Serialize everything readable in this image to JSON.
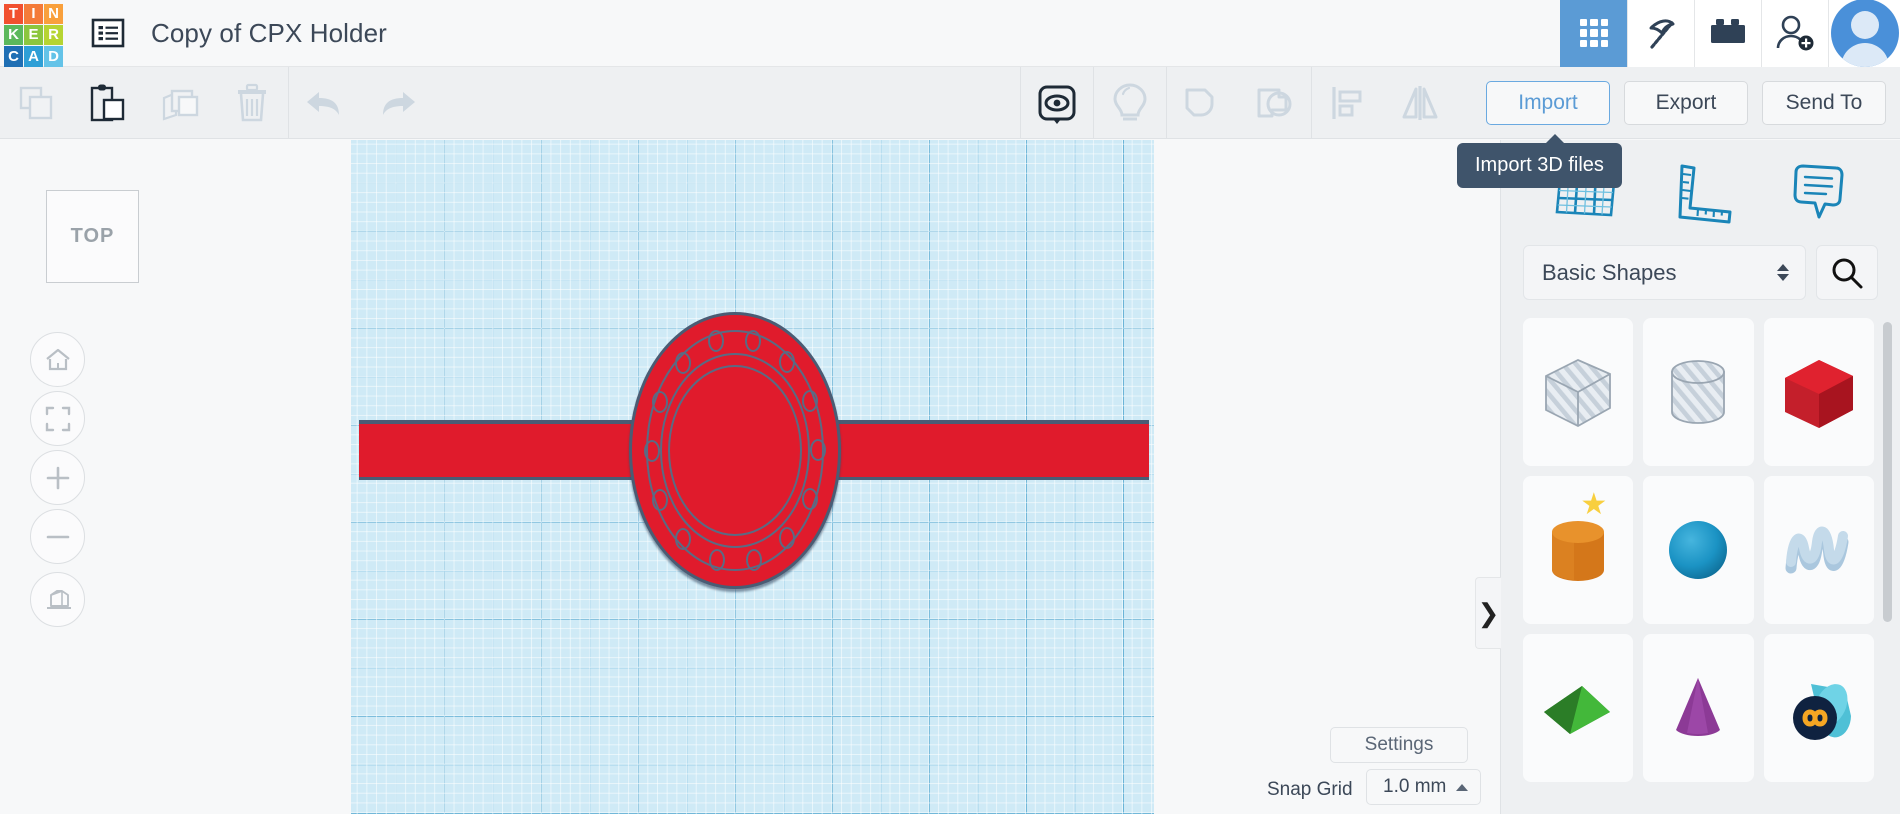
{
  "app": {
    "name": "Tinkercad",
    "logo_letters": [
      {
        "ch": "T",
        "color": "#f1502f"
      },
      {
        "ch": "I",
        "color": "#f47b39"
      },
      {
        "ch": "N",
        "color": "#f9a03c"
      },
      {
        "ch": "K",
        "color": "#5cb85c"
      },
      {
        "ch": "E",
        "color": "#8cc63e"
      },
      {
        "ch": "R",
        "color": "#b6d432"
      },
      {
        "ch": "C",
        "color": "#1f6fb4"
      },
      {
        "ch": "A",
        "color": "#2e9fd6"
      },
      {
        "ch": "D",
        "color": "#64c3e8"
      }
    ]
  },
  "header": {
    "document_title": "Copy of CPX Holder",
    "doc_menu_icon": "list-icon",
    "buttons": [
      {
        "name": "design-grid-button",
        "icon": "grid-9-icon",
        "active": true
      },
      {
        "name": "codeblocks-button",
        "icon": "pickaxe-icon",
        "active": false
      },
      {
        "name": "blocks-button",
        "icon": "brick-icon",
        "active": false
      },
      {
        "name": "invite-button",
        "icon": "add-user-icon",
        "active": false
      }
    ],
    "avatar": "user-avatar"
  },
  "toolbar": {
    "left_tools": [
      {
        "name": "copy-button",
        "icon": "copy-icon",
        "enabled": false
      },
      {
        "name": "paste-button",
        "icon": "clipboard-paste-icon",
        "enabled": true
      },
      {
        "name": "duplicate-button",
        "icon": "duplicate-icon",
        "enabled": false
      },
      {
        "name": "delete-button",
        "icon": "trash-icon",
        "enabled": false
      },
      {
        "name": "undo-button",
        "icon": "undo-arrow-icon",
        "enabled": false
      },
      {
        "name": "redo-button",
        "icon": "redo-arrow-icon",
        "enabled": false
      }
    ],
    "mid_tools": [
      {
        "name": "show-hide-button",
        "icon": "eye-icon",
        "enabled": true
      },
      {
        "name": "solid-hole-button",
        "icon": "lightbulb-icon",
        "enabled": false
      },
      {
        "name": "group-button",
        "icon": "group-shapes-icon",
        "enabled": false
      },
      {
        "name": "ungroup-button",
        "icon": "ungroup-shapes-icon",
        "enabled": false
      },
      {
        "name": "align-button",
        "icon": "align-icon",
        "enabled": false
      },
      {
        "name": "mirror-button",
        "icon": "mirror-icon",
        "enabled": false
      }
    ],
    "import_label": "Import",
    "export_label": "Export",
    "sendto_label": "Send To",
    "import_tooltip": "Import 3D files",
    "accent_blue": "#5b9bd5"
  },
  "view_controls": {
    "viewcube_label": "TOP",
    "buttons": [
      {
        "name": "home-view-button",
        "icon": "home-icon"
      },
      {
        "name": "fit-to-view-button",
        "icon": "fit-frame-icon"
      },
      {
        "name": "zoom-in-button",
        "icon": "plus-icon"
      },
      {
        "name": "zoom-out-button",
        "icon": "minus-icon"
      },
      {
        "name": "perspective-toggle-button",
        "icon": "ortho-box-icon"
      }
    ]
  },
  "canvas": {
    "workplane_color": "#cfeaf6",
    "model_name": "cpx-holder",
    "parts": [
      {
        "name": "strap",
        "color": "#e01b2c",
        "outline": "#4a5c74"
      },
      {
        "name": "circular-mount-disc",
        "color": "#e01b2c",
        "outline": "#4a5c74",
        "hole_count": 14
      }
    ]
  },
  "panel": {
    "tools": [
      {
        "name": "workplane-tool",
        "icon": "workplane-grid-icon"
      },
      {
        "name": "ruler-tool",
        "icon": "ruler-icon"
      },
      {
        "name": "note-tool",
        "icon": "note-bubble-icon"
      }
    ],
    "collection_label": "Basic Shapes",
    "search_icon": "search-icon",
    "stepper_icon": "updown-stepper-icon",
    "collapse_icon": "chevron-right-icon",
    "shapes": [
      {
        "name": "shape-box-hole",
        "label": "Box Hole",
        "kind": "box-striped"
      },
      {
        "name": "shape-cylinder-hole",
        "label": "Cylinder Hole",
        "kind": "cylinder-striped"
      },
      {
        "name": "shape-box",
        "label": "Box",
        "kind": "box",
        "color": "#cc1f2d"
      },
      {
        "name": "shape-cylinder",
        "label": "Cylinder",
        "kind": "cylinder",
        "color": "#d9801f",
        "featured": true
      },
      {
        "name": "shape-sphere",
        "label": "Sphere",
        "kind": "sphere",
        "color": "#1b93c4"
      },
      {
        "name": "shape-scribble",
        "label": "Scribble",
        "kind": "scribble",
        "color": "#a9c6de"
      },
      {
        "name": "shape-pyramid",
        "label": "Pyramid",
        "kind": "pyramid",
        "color": "#3ba335"
      },
      {
        "name": "shape-cone",
        "label": "Cone",
        "kind": "cone",
        "color": "#8c3a96"
      },
      {
        "name": "shape-codeblocks",
        "label": "Codeblocks Shape",
        "kind": "codeblocks",
        "color": "#3fb0c9"
      }
    ]
  },
  "bottom": {
    "settings_label": "Settings",
    "snapgrid_label": "Snap Grid",
    "snapgrid_value": "1.0 mm",
    "snapgrid_caret": "caret-up-icon"
  }
}
